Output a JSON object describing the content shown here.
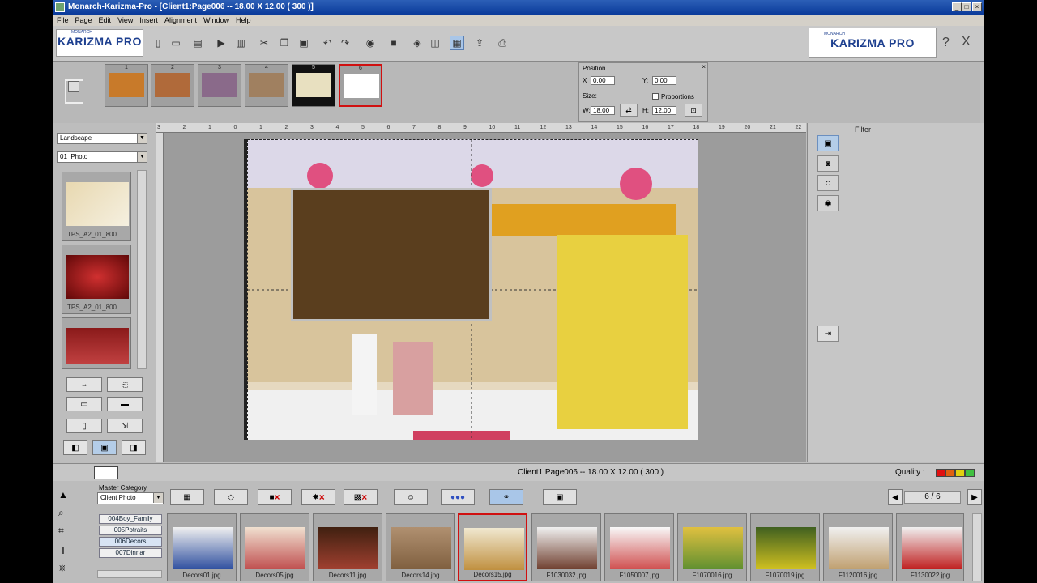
{
  "window": {
    "title": "Monarch-Karizma-Pro - [Client1:Page006 -- 18.00 X 12.00 ( 300 )]",
    "controls": [
      "_",
      "□",
      "×"
    ]
  },
  "menu": [
    "File",
    "Page",
    "Edit",
    "View",
    "Insert",
    "Alignment",
    "Window",
    "Help"
  ],
  "logo": {
    "small": "MONARCH",
    "brand": "KARIZMA PRO"
  },
  "toolbar": {
    "icons": [
      "new-icon",
      "open-icon",
      "save-icon",
      "play-icon",
      "film-icon",
      "cut-icon",
      "copy-icon",
      "paste-icon",
      "undo-icon",
      "redo-icon",
      "camera-icon",
      "monitor-icon",
      "align-center-icon",
      "split-icon",
      "layout-icon",
      "export-icon",
      "print-icon"
    ],
    "help_label": "?",
    "close_label": "X"
  },
  "pages": [
    {
      "num": "1",
      "color": "#c87a2a"
    },
    {
      "num": "2",
      "color": "#b06a3a"
    },
    {
      "num": "3",
      "color": "#8a6a8a"
    },
    {
      "num": "4",
      "color": "#a08060"
    },
    {
      "num": "5",
      "color": "#222222"
    },
    {
      "num": "6",
      "color": "#ffffff"
    }
  ],
  "position": {
    "title": "Position",
    "x_label": "X",
    "x_value": "0.00",
    "y_label": "Y:",
    "y_value": "0.00",
    "size_label": "Size:",
    "proportions_label": "Proportions",
    "w_label": "W:",
    "w_value": "18.00",
    "h_label": "H:",
    "h_value": "12.00"
  },
  "left": {
    "orientation": "Landscape",
    "category": "01_Photo",
    "templates": [
      {
        "caption": "TPS_A2_01_800...",
        "color": "#e8d8b0"
      },
      {
        "caption": "TPS_A2_01_800...",
        "color": "#9a1010"
      },
      {
        "caption": "",
        "color": "#8a1a1a"
      }
    ]
  },
  "ruler": {
    "ticks": [
      "3",
      "2",
      "1",
      "0",
      "1",
      "2",
      "3",
      "4",
      "5",
      "6",
      "7",
      "8",
      "9",
      "10",
      "11",
      "12",
      "13",
      "14",
      "15",
      "16",
      "17",
      "18",
      "19",
      "20",
      "21",
      "22"
    ]
  },
  "filter": {
    "title": "Filter"
  },
  "status": {
    "text": "Client1:Page006 -- 18.00 X 12.00 ( 300 )",
    "quality_label": "Quality :",
    "quality_colors": [
      "#e01010",
      "#e06010",
      "#e0d010",
      "#40c040"
    ]
  },
  "bottom": {
    "master_category_label": "Master Category",
    "master_category_value": "Client Photo",
    "categories": [
      "004Boy_Family",
      "005Potraits",
      "006Decors",
      "007Dinnar"
    ],
    "selected_category": "006Decors",
    "pager": "6 / 6",
    "library": [
      {
        "name": "Decors01.jpg",
        "color": "#3050a0"
      },
      {
        "name": "Decors05.jpg",
        "color": "#c05050"
      },
      {
        "name": "Decors11.jpg",
        "color": "#a04030"
      },
      {
        "name": "Decors14.jpg",
        "color": "#806040"
      },
      {
        "name": "Decors15.jpg",
        "color": "#c09040"
      },
      {
        "name": "F1030032.jpg",
        "color": "#704030"
      },
      {
        "name": "F1050007.jpg",
        "color": "#d05050"
      },
      {
        "name": "F1070016.jpg",
        "color": "#609030"
      },
      {
        "name": "F1070019.jpg",
        "color": "#d0c020"
      },
      {
        "name": "F1120016.jpg",
        "color": "#c0a070"
      },
      {
        "name": "F1130022.jpg",
        "color": "#c02020"
      }
    ]
  },
  "canvas": {
    "backdrop_color": "#e6d9c0",
    "photo1_color": "#5a3e1e",
    "photo2_color": "#e8d040"
  }
}
